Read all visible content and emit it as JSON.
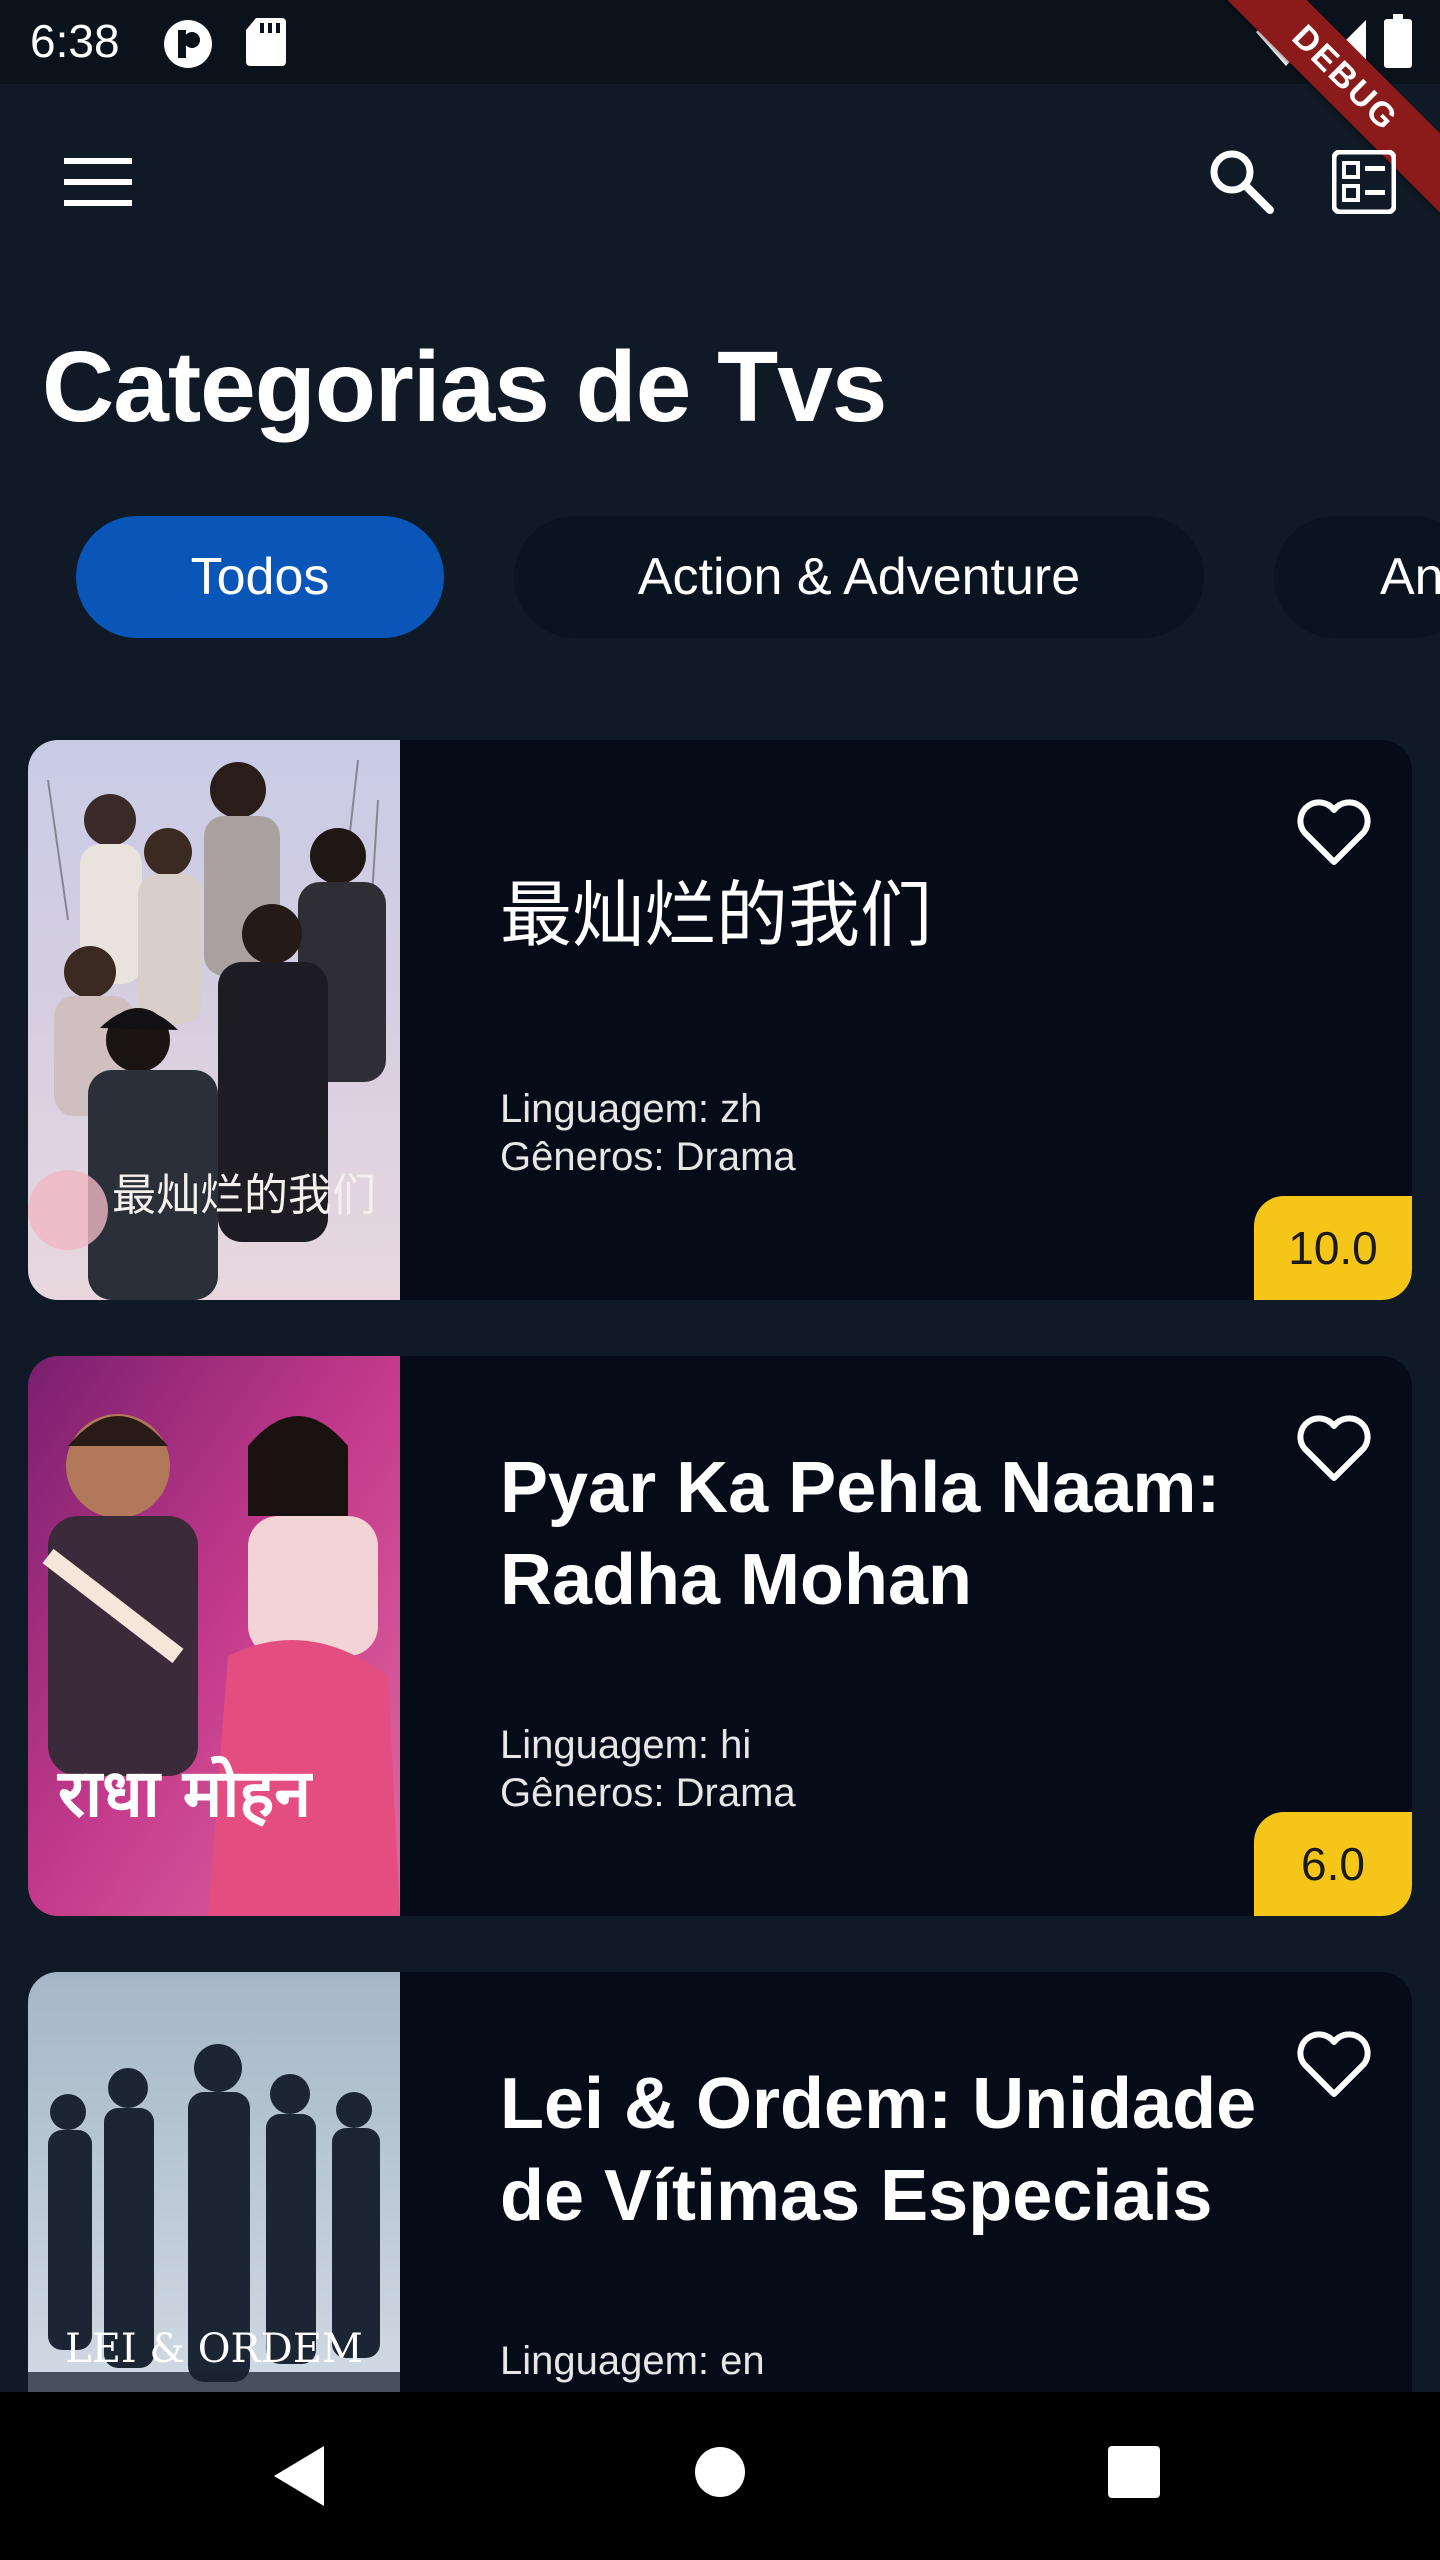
{
  "status_bar": {
    "time": "6:38"
  },
  "debug_label": "DEBUG",
  "page_title": "Categorias de Tvs",
  "chips": [
    {
      "label": "Todos",
      "selected": true
    },
    {
      "label": "Action & Adventure",
      "selected": false
    },
    {
      "label": "An",
      "selected": false
    }
  ],
  "cards": [
    {
      "title": "最灿烂的我们",
      "language": "Linguagem: zh",
      "genres": "Gêneros: Drama",
      "rating": "10.0",
      "poster_text": "最灿烂的我们"
    },
    {
      "title": "Pyar Ka Pehla Naam: Radha Mohan",
      "language": "Linguagem: hi",
      "genres": "Gêneros: Drama",
      "rating": "6.0",
      "poster_text": "राधा मोहन"
    },
    {
      "title": "Lei & Ordem: Unidade de Vítimas Especiais",
      "language": "Linguagem: en",
      "poster_text": "LEI & ORDEM"
    }
  ],
  "colors": {
    "background": "#0f1a26",
    "card": "#060b18",
    "chip_selected": "#0a55b8",
    "rating_badge": "#f5c518"
  },
  "icons": [
    "menu-icon",
    "search-icon",
    "list-view-icon",
    "heart-icon",
    "back-icon",
    "home-icon",
    "recents-icon"
  ]
}
